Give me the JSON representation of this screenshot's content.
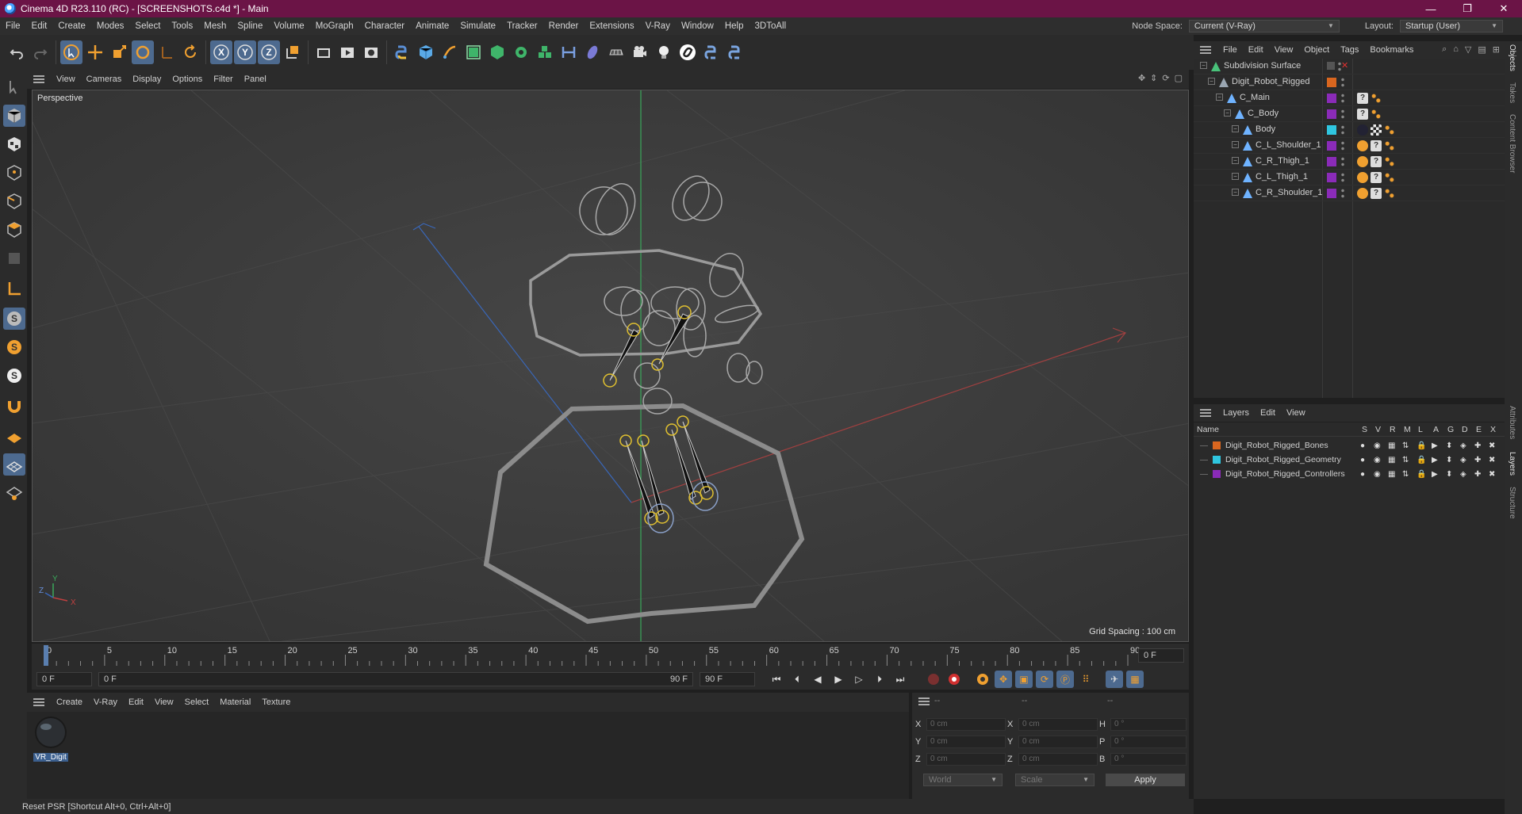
{
  "window": {
    "title": "Cinema 4D R23.110 (RC) - [SCREENSHOTS.c4d *] - Main",
    "controls": {
      "minimize": "—",
      "maximize": "❐",
      "close": "✕"
    }
  },
  "menu": {
    "items": [
      "File",
      "Edit",
      "Create",
      "Modes",
      "Select",
      "Tools",
      "Mesh",
      "Spline",
      "Volume",
      "MoGraph",
      "Character",
      "Animate",
      "Simulate",
      "Tracker",
      "Render",
      "Extensions",
      "V-Ray",
      "Window",
      "Help",
      "3DToAll"
    ],
    "node_space_label": "Node Space:",
    "node_space_value": "Current (V-Ray)",
    "layout_label": "Layout:",
    "layout_value": "Startup (User)"
  },
  "toolbar": {
    "axis_x": "X",
    "axis_y": "Y",
    "axis_z": "Z"
  },
  "viewport_menu": [
    "View",
    "Cameras",
    "Display",
    "Options",
    "Filter",
    "Panel"
  ],
  "viewport": {
    "label": "Perspective",
    "grid_spacing": "Grid Spacing : 100 cm",
    "axis_x": "X",
    "axis_y": "Y",
    "axis_z": "Z"
  },
  "timeline": {
    "ticks": [
      "0",
      "5",
      "10",
      "15",
      "20",
      "25",
      "30",
      "35",
      "40",
      "45",
      "50",
      "55",
      "60",
      "65",
      "70",
      "75",
      "80",
      "85",
      "90"
    ],
    "current_frame": "0 F"
  },
  "transport": {
    "start": "0 F",
    "range_start": "0 F",
    "range_end": "90 F",
    "end": "90 F"
  },
  "material_menu": [
    "Create",
    "V-Ray",
    "Edit",
    "View",
    "Select",
    "Material",
    "Texture"
  ],
  "materials": [
    {
      "name": "VR_Digit"
    }
  ],
  "attributes": {
    "header": [
      "--",
      "--",
      "--"
    ],
    "rows": [
      {
        "l1": "X",
        "v1": "0 cm",
        "l2": "X",
        "v2": "0 cm",
        "l3": "H",
        "v3": "0 °"
      },
      {
        "l1": "Y",
        "v1": "0 cm",
        "l2": "Y",
        "v2": "0 cm",
        "l3": "P",
        "v3": "0 °"
      },
      {
        "l1": "Z",
        "v1": "0 cm",
        "l2": "Z",
        "v2": "0 cm",
        "l3": "B",
        "v3": "0 °"
      }
    ],
    "coord_mode": "World",
    "scale_mode": "Scale",
    "apply": "Apply"
  },
  "status": "Reset PSR [Shortcut Alt+0, Ctrl+Alt+0]",
  "object_menu": [
    "File",
    "Edit",
    "View",
    "Object",
    "Tags",
    "Bookmarks"
  ],
  "objects": [
    {
      "name": "Subdivision Surface",
      "indent": 0,
      "color": "",
      "icon": "#49c27a"
    },
    {
      "name": "Digit_Robot_Rigged",
      "indent": 1,
      "color": "#d9661f",
      "icon": "#9aa6b2"
    },
    {
      "name": "C_Main",
      "indent": 2,
      "color": "#8a2bb8",
      "icon": "#6fb3ff"
    },
    {
      "name": "C_Body",
      "indent": 3,
      "color": "#8a2bb8",
      "icon": "#6fb3ff"
    },
    {
      "name": "Body",
      "indent": 4,
      "color": "#2fc6e0",
      "icon": "#6fb3ff"
    },
    {
      "name": "C_L_Shoulder_1",
      "indent": 4,
      "color": "#8a2bb8",
      "icon": "#6fb3ff"
    },
    {
      "name": "C_R_Thigh_1",
      "indent": 4,
      "color": "#8a2bb8",
      "icon": "#6fb3ff"
    },
    {
      "name": "C_L_Thigh_1",
      "indent": 4,
      "color": "#8a2bb8",
      "icon": "#6fb3ff"
    },
    {
      "name": "C_R_Shoulder_1",
      "indent": 4,
      "color": "#8a2bb8",
      "icon": "#6fb3ff"
    }
  ],
  "layers_menu": [
    "Layers",
    "Edit",
    "View"
  ],
  "layers_header": {
    "name": "Name",
    "cols": [
      "S",
      "V",
      "R",
      "M",
      "L",
      "A",
      "G",
      "D",
      "E",
      "X"
    ]
  },
  "layers": [
    {
      "name": "Digit_Robot_Rigged_Bones",
      "color": "#d9661f"
    },
    {
      "name": "Digit_Robot_Rigged_Geometry",
      "color": "#2fc6e0"
    },
    {
      "name": "Digit_Robot_Rigged_Controllers",
      "color": "#8a2bb8"
    }
  ],
  "side_tabs": [
    "Objects",
    "Takes",
    "Content Browser",
    "Attributes",
    "Layers",
    "Structure"
  ]
}
